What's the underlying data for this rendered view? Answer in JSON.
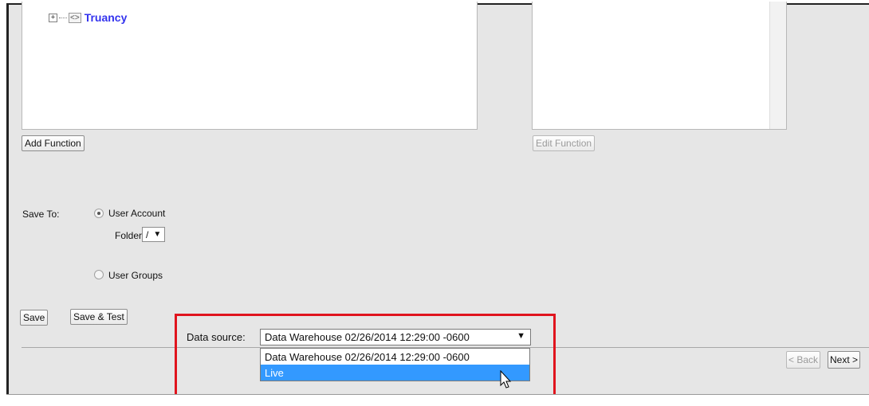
{
  "tree": {
    "items": [
      {
        "label": "Truancy",
        "expander": "+",
        "icon": "code-icon"
      }
    ]
  },
  "buttons": {
    "add_function": "Add Function",
    "edit_function": "Edit Function",
    "save": "Save",
    "save_test": "Save & Test",
    "back": "< Back",
    "next": "Next >"
  },
  "save_to": {
    "label": "Save To:",
    "options": [
      {
        "label": "User Account",
        "checked": true
      },
      {
        "label": "User Groups",
        "checked": false
      }
    ],
    "folder_label": "Folder:",
    "folder_value": "/"
  },
  "data_source": {
    "label": "Data source:",
    "selected": "Data Warehouse 02/26/2014 12:29:00 -0600",
    "options": [
      "Data Warehouse 02/26/2014 12:29:00 -0600",
      "Live"
    ],
    "highlighted_index": 1
  },
  "colors": {
    "highlight": "#e0141e",
    "selection": "#3399ff",
    "link": "#3333ee"
  }
}
